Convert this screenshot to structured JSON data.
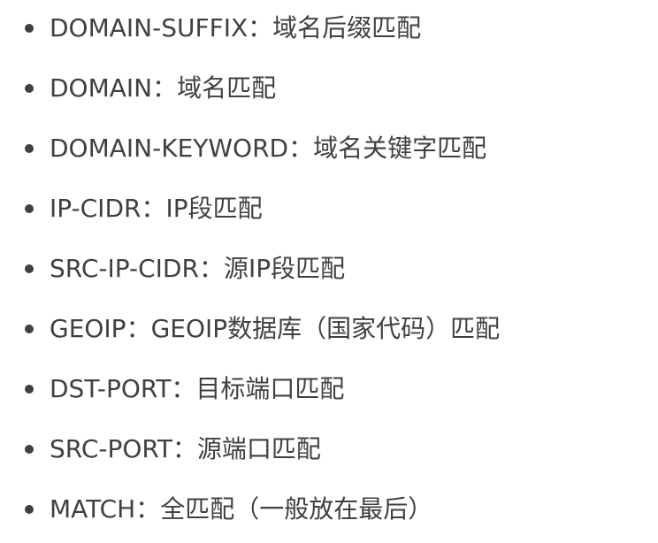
{
  "items": [
    {
      "label": "DOMAIN-SUFFIX：域名后缀匹配"
    },
    {
      "label": "DOMAIN：域名匹配"
    },
    {
      "label": "DOMAIN-KEYWORD：域名关键字匹配"
    },
    {
      "label": "IP-CIDR：IP段匹配"
    },
    {
      "label": "SRC-IP-CIDR：源IP段匹配"
    },
    {
      "label": "GEOIP：GEOIP数据库（国家代码）匹配"
    },
    {
      "label": "DST-PORT：目标端口匹配"
    },
    {
      "label": "SRC-PORT：源端口匹配"
    },
    {
      "label": "MATCH：全匹配（一般放在最后）"
    }
  ]
}
